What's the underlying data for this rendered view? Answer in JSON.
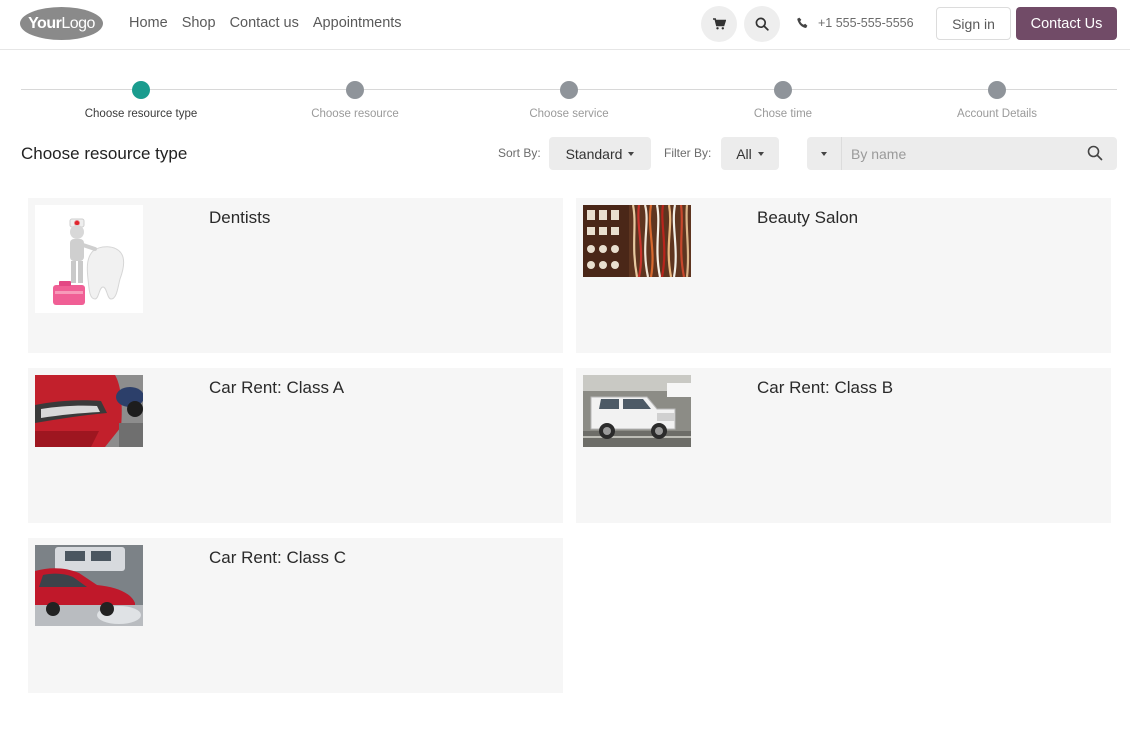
{
  "header": {
    "logo_bold": "Your",
    "logo_light": "Logo",
    "nav": [
      "Home",
      "Shop",
      "Contact us",
      "Appointments"
    ],
    "phone": "+1 555-555-5556",
    "signin_label": "Sign in",
    "contact_label": "Contact Us",
    "icons": {
      "cart": "cart-icon",
      "search": "search-icon",
      "phone": "phone-icon"
    }
  },
  "steps": [
    {
      "label": "Choose resource type",
      "active": true
    },
    {
      "label": "Choose resource",
      "active": false
    },
    {
      "label": "Choose service",
      "active": false
    },
    {
      "label": "Chose time",
      "active": false
    },
    {
      "label": "Account Details",
      "active": false
    }
  ],
  "toolbar": {
    "heading": "Choose resource type",
    "sort_label": "Sort By:",
    "sort_value": "Standard",
    "filter_label": "Filter By:",
    "filter_value": "All",
    "search_placeholder": "By name"
  },
  "cards": [
    {
      "title": "Dentists",
      "image": "dentist-figurine-image"
    },
    {
      "title": "Beauty Salon",
      "image": "beauty-salon-image"
    },
    {
      "title": "Car Rent: Class A",
      "image": "red-car-headlight-image"
    },
    {
      "title": "Car Rent: Class B",
      "image": "white-suv-image"
    },
    {
      "title": "Car Rent: Class C",
      "image": "red-car-parking-image"
    }
  ],
  "colors": {
    "brand": "#714b67",
    "active_step": "#1a9c8e",
    "inactive_step": "#8f949a",
    "card_bg": "#f6f6f6"
  }
}
